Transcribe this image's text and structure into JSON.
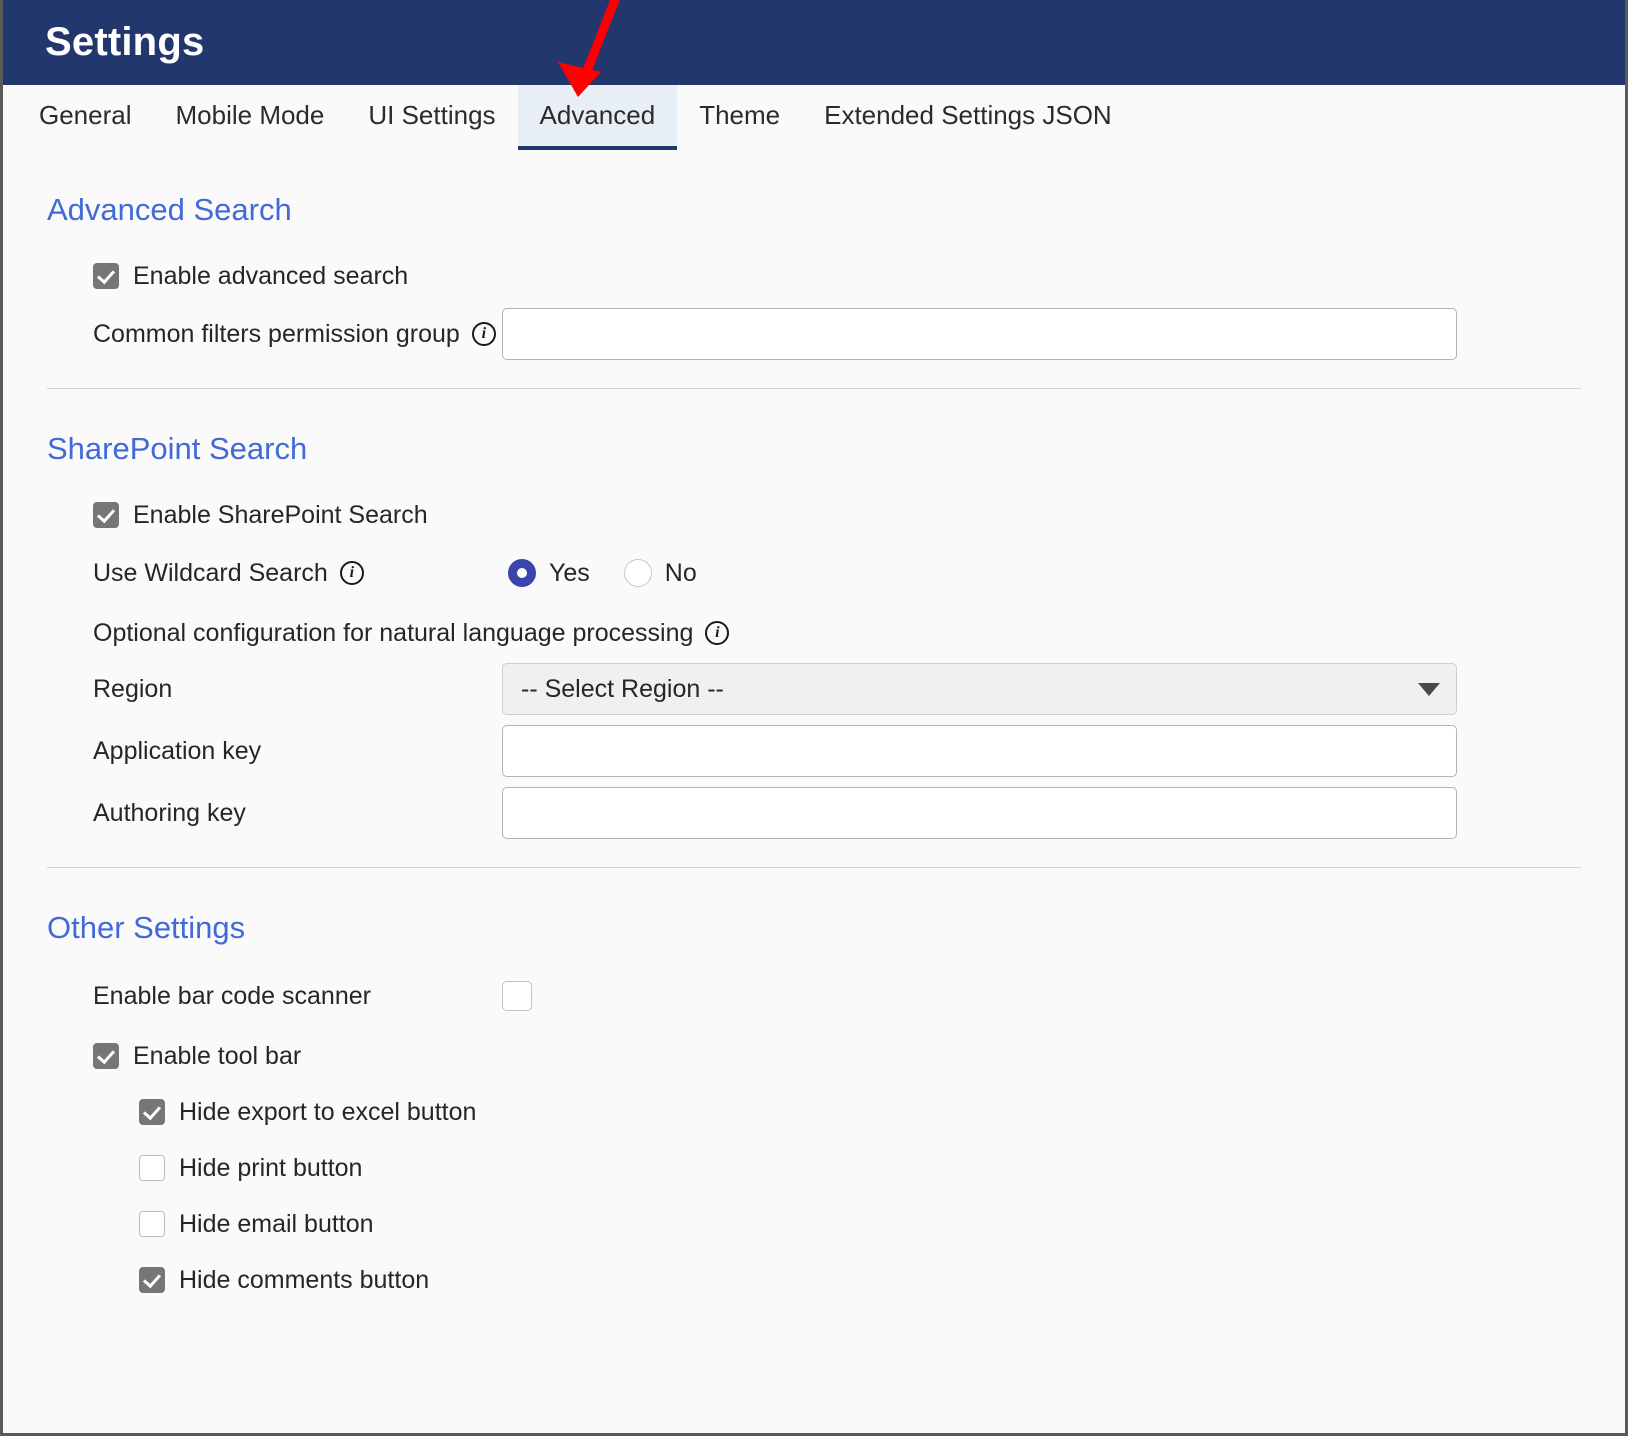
{
  "window": {
    "title": "Settings",
    "header_color": "#21376e",
    "accent_color": "#4169d8"
  },
  "tabs": [
    {
      "label": "General",
      "active": false
    },
    {
      "label": "Mobile Mode",
      "active": false
    },
    {
      "label": "UI Settings",
      "active": false
    },
    {
      "label": "Advanced",
      "active": true
    },
    {
      "label": "Theme",
      "active": false
    },
    {
      "label": "Extended Settings JSON",
      "active": false
    }
  ],
  "sections": {
    "advanced_search": {
      "title": "Advanced Search",
      "enable_checkbox_label": "Enable advanced search",
      "enable_checkbox_checked": "checked",
      "common_filters_label": "Common filters permission group",
      "common_filters_value": "",
      "common_filters_placeholder": "",
      "info_glyph": "i"
    },
    "sharepoint_search": {
      "title": "SharePoint Search",
      "enable_checkbox_label": "Enable SharePoint Search",
      "enable_checkbox_checked": "checked",
      "wildcard_label": "Use Wildcard Search",
      "wildcard_selected": "Yes",
      "wildcard_options": [
        "Yes",
        "No"
      ],
      "nlp_note": "Optional configuration for natural language processing",
      "region_label": "Region",
      "region_selected": "-- Select Region --",
      "application_key_label": "Application key",
      "application_key_value": "",
      "authoring_key_label": "Authoring key",
      "authoring_key_value": ""
    },
    "other_settings": {
      "title": "Other Settings",
      "bar_code_label": "Enable bar code scanner",
      "bar_code_checked": "unchecked",
      "tool_bar_label": "Enable tool bar",
      "tool_bar_checked": "checked",
      "sub_items": [
        {
          "label": "Hide export to excel button",
          "checked": "checked"
        },
        {
          "label": "Hide print button",
          "checked": "unchecked"
        },
        {
          "label": "Hide email button",
          "checked": "unchecked"
        },
        {
          "label": "Hide comments button",
          "checked": "checked"
        }
      ]
    }
  },
  "annotation": {
    "type": "red-arrow",
    "points_to": "Advanced",
    "color": "#ff0000"
  },
  "icons": {
    "info": "info-icon",
    "caret_down": "chevron-down-icon",
    "arrow": "red-arrow-annotation-icon"
  }
}
